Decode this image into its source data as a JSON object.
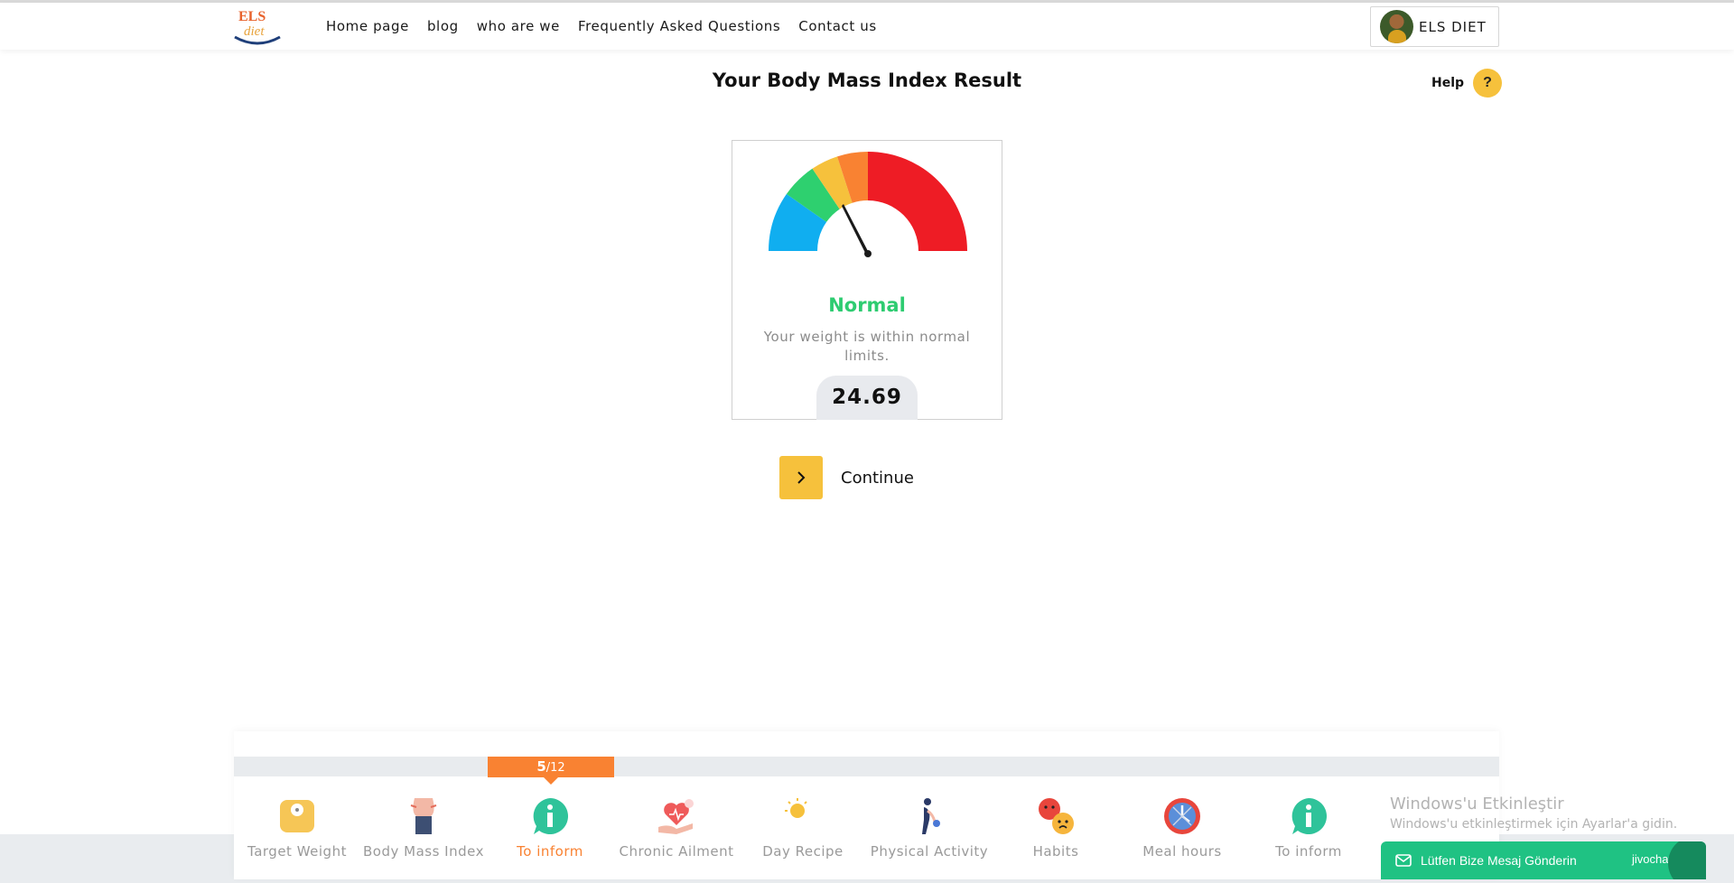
{
  "header": {
    "logo_text": "ELS diet",
    "nav": [
      "Home page",
      "blog",
      "who are we",
      "Frequently Asked Questions",
      "Contact us"
    ],
    "user_name": "ELS DIET"
  },
  "page": {
    "title": "Your Body Mass Index Result",
    "help_label": "Help",
    "help_icon_text": "?"
  },
  "result": {
    "status": "Normal",
    "status_color": "#2ecc71",
    "description": "Your weight is within normal limits.",
    "bmi_value": "24.69",
    "gauge_segments": [
      {
        "name": "underweight",
        "color": "#10aef0"
      },
      {
        "name": "normal",
        "color": "#2ed06f"
      },
      {
        "name": "overweight",
        "color": "#f6c13c"
      },
      {
        "name": "obese",
        "color": "#f98232"
      },
      {
        "name": "extremely-obese",
        "color": "#ee1c25"
      }
    ]
  },
  "actions": {
    "continue_label": "Continue"
  },
  "progress": {
    "current": "5",
    "total": "/12",
    "steps": [
      {
        "label": "Target Weight",
        "icon": "scale-icon"
      },
      {
        "label": "Body Mass Index",
        "icon": "body-icon"
      },
      {
        "label": "To inform",
        "icon": "info-icon",
        "active": true
      },
      {
        "label": "Chronic Ailment",
        "icon": "heart-hand-icon"
      },
      {
        "label": "Day Recipe",
        "icon": "sun-moon-icon"
      },
      {
        "label": "Physical Activity",
        "icon": "exercise-icon"
      },
      {
        "label": "Habits",
        "icon": "emoji-faces-icon"
      },
      {
        "label": "Meal hours",
        "icon": "clock-icon"
      },
      {
        "label": "To inform",
        "icon": "info-icon"
      }
    ]
  },
  "watermark": {
    "title": "Windows'u Etkinleştir",
    "subtitle": "Windows'u etkinleştirmek için Ayarlar'a gidin."
  },
  "chat": {
    "label": "Lütfen Bize Mesaj Gönderin",
    "brand": "jivochat"
  }
}
